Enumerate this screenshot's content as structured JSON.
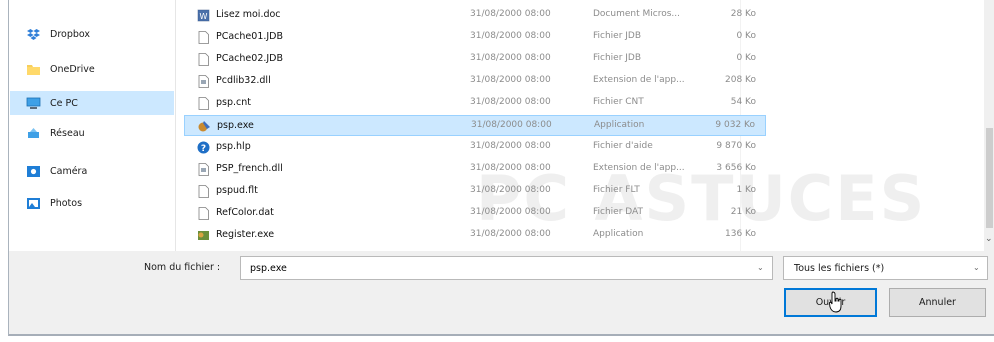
{
  "sidebar": {
    "items": [
      {
        "label": "Dropbox",
        "icon": "dropbox-icon"
      },
      {
        "label": "OneDrive",
        "icon": "onedrive-folder-icon"
      },
      {
        "label": "Ce PC",
        "icon": "computer-icon",
        "selected": true
      },
      {
        "label": "Réseau",
        "icon": "network-icon"
      },
      {
        "label": "Caméra",
        "icon": "camera-folder-icon"
      },
      {
        "label": "Photos",
        "icon": "photos-folder-icon"
      }
    ]
  },
  "files": [
    {
      "name": "Lisez moi.doc",
      "date": "31/08/2000 08:00",
      "type": "Document Micros...",
      "size": "28 Ko",
      "icon": "word-document-icon"
    },
    {
      "name": "PCache01.JDB",
      "date": "31/08/2000 08:00",
      "type": "Fichier JDB",
      "size": "0 Ko",
      "icon": "blank-file-icon"
    },
    {
      "name": "PCache02.JDB",
      "date": "31/08/2000 08:00",
      "type": "Fichier JDB",
      "size": "0 Ko",
      "icon": "blank-file-icon"
    },
    {
      "name": "Pcdlib32.dll",
      "date": "31/08/2000 08:00",
      "type": "Extension de l'app...",
      "size": "208 Ko",
      "icon": "dll-file-icon"
    },
    {
      "name": "psp.cnt",
      "date": "31/08/2000 08:00",
      "type": "Fichier CNT",
      "size": "54 Ko",
      "icon": "blank-file-icon"
    },
    {
      "name": "psp.exe",
      "date": "31/08/2000 08:00",
      "type": "Application",
      "size": "9 032 Ko",
      "icon": "psp-app-icon",
      "selected": true
    },
    {
      "name": "psp.hlp",
      "date": "31/08/2000 08:00",
      "type": "Fichier d'aide",
      "size": "9 870 Ko",
      "icon": "help-file-icon"
    },
    {
      "name": "PSP_french.dll",
      "date": "31/08/2000 08:00",
      "type": "Extension de l'app...",
      "size": "3 656 Ko",
      "icon": "dll-file-icon"
    },
    {
      "name": "pspud.flt",
      "date": "31/08/2000 08:00",
      "type": "Fichier FLT",
      "size": "1 Ko",
      "icon": "blank-file-icon"
    },
    {
      "name": "RefColor.dat",
      "date": "31/08/2000 08:00",
      "type": "Fichier DAT",
      "size": "21 Ko",
      "icon": "blank-file-icon"
    },
    {
      "name": "Register.exe",
      "date": "31/08/2000 08:00",
      "type": "Application",
      "size": "136 Ko",
      "icon": "register-app-icon"
    }
  ],
  "watermark": "PC ASTUCES",
  "filename": {
    "label": "Nom du fichier :",
    "value": "psp.exe"
  },
  "filter": {
    "value": "Tous les fichiers (*)"
  },
  "buttons": {
    "open": "Ouvrir",
    "cancel": "Annuler"
  },
  "colors": {
    "selection": "#cce8ff",
    "accent": "#0078d7"
  }
}
